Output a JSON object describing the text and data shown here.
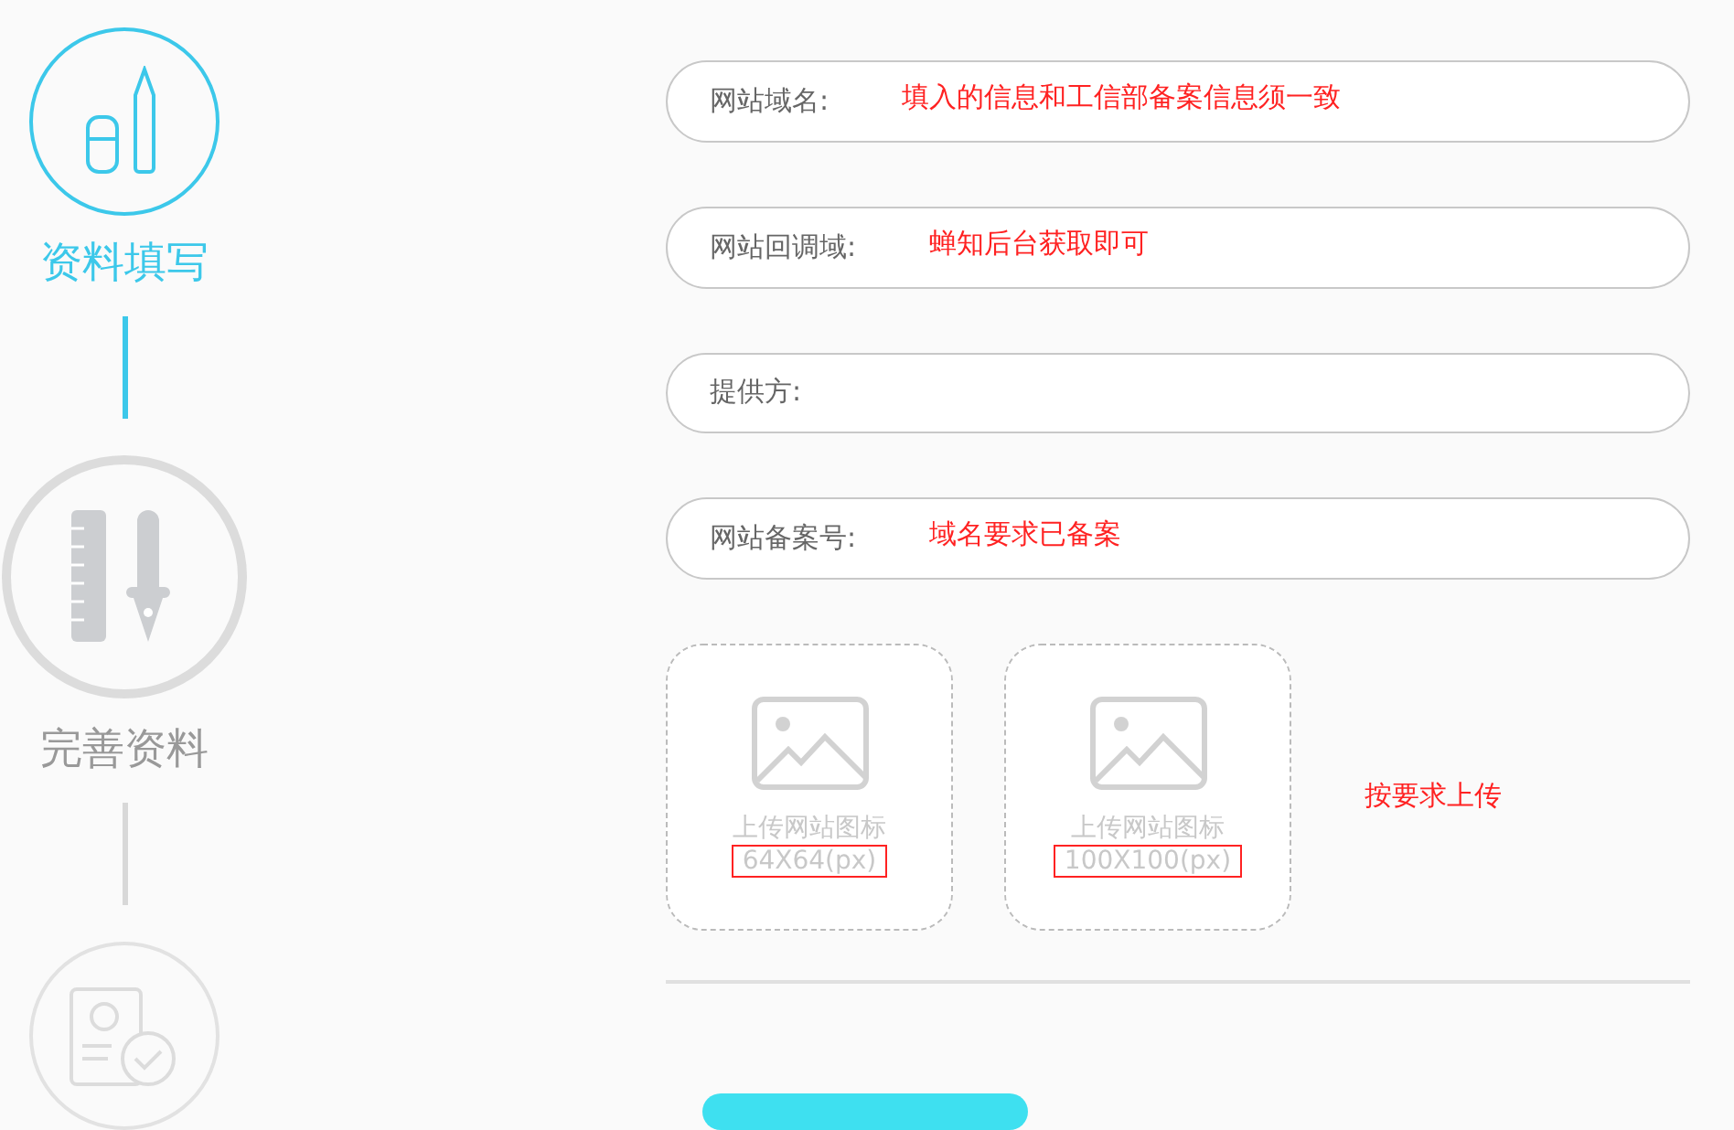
{
  "steps": [
    {
      "label": "资料填写",
      "selected": true,
      "emphasized": false
    },
    {
      "label": "完善资料",
      "selected": false,
      "emphasized": true
    },
    {
      "selected": false,
      "emphasized": false
    }
  ],
  "fields": [
    {
      "label": "网站域名:",
      "note": "填入的信息和工信部备案信息须一致"
    },
    {
      "label": "网站回调域:",
      "note": "蝉知后台获取即可"
    },
    {
      "label": "提供方:"
    },
    {
      "label": "网站备案号:",
      "note": "域名要求已备案"
    }
  ],
  "uploads": [
    {
      "label": "上传网站图标",
      "size": "64X64(px)",
      "highlighted": true
    },
    {
      "label": "上传网站图标",
      "size": "100X100(px)",
      "highlighted": true
    }
  ],
  "upload_note": "按要求上传"
}
